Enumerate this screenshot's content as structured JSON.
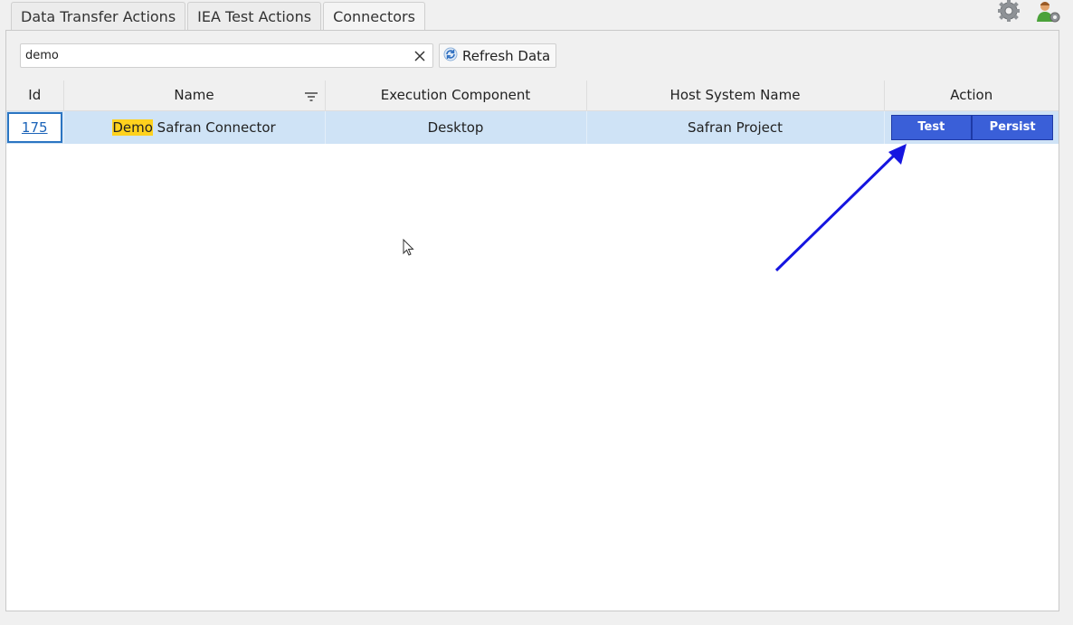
{
  "tabs": [
    {
      "label": "Data Transfer Actions",
      "active": false
    },
    {
      "label": "IEA Test Actions",
      "active": false
    },
    {
      "label": "Connectors",
      "active": true
    }
  ],
  "top_icons": [
    "gear-icon",
    "user-settings-icon"
  ],
  "search": {
    "value": "demo",
    "clear_icon": "close-icon"
  },
  "refresh_button": {
    "label": "Refresh Data",
    "icon": "refresh-icon"
  },
  "table": {
    "columns": [
      "Id",
      "Name",
      "Execution Component",
      "Host System Name",
      "Action"
    ],
    "rows": [
      {
        "id": "175",
        "name_highlight": "Demo",
        "name_rest": " Safran Connector",
        "execution_component": "Desktop",
        "host_system_name": "Safran Project",
        "actions": [
          "Test",
          "Persist"
        ]
      }
    ]
  },
  "colors": {
    "selected_row": "#cfe3f6",
    "action_button": "#3a5fd8",
    "highlight": "#ffd21e",
    "annotation_arrow": "#1515e0"
  }
}
